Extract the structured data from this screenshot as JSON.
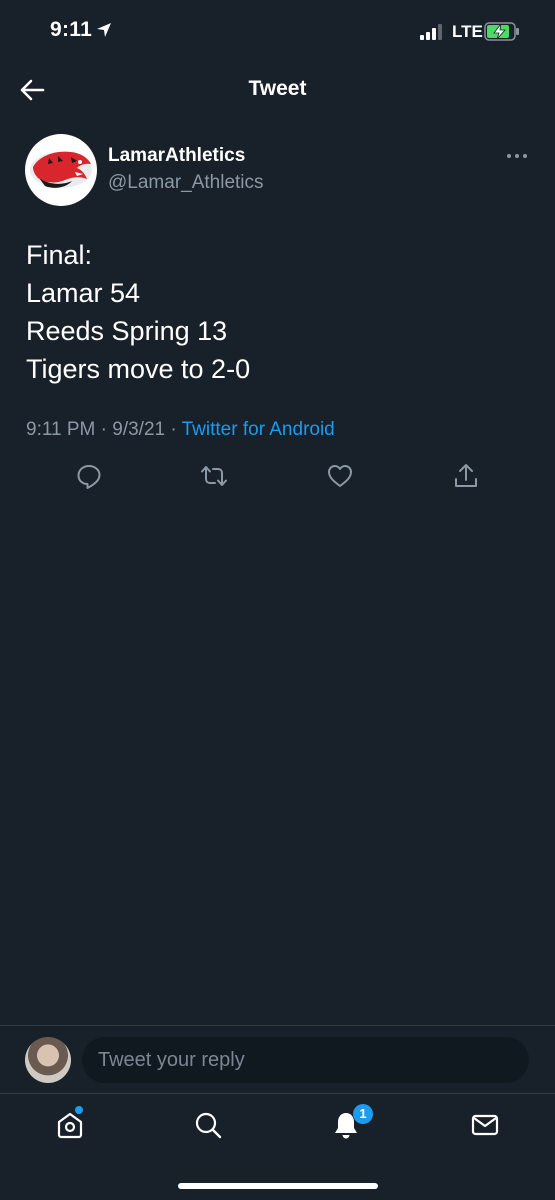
{
  "status_bar": {
    "time": "9:11",
    "carrier": "LTE"
  },
  "header": {
    "title": "Tweet"
  },
  "tweet": {
    "display_name": "LamarAthletics",
    "handle": "@Lamar_Athletics",
    "text_lines": [
      "Final:",
      "Lamar 54",
      "Reeds Spring 13",
      "Tigers move to 2-0"
    ],
    "time": "9:11 PM",
    "date": "9/3/21",
    "source": "Twitter for Android",
    "separator": "·"
  },
  "reply": {
    "placeholder": "Tweet your reply"
  },
  "tab_bar": {
    "notifications_badge": "1"
  },
  "colors": {
    "background": "#182029",
    "accent": "#1d9bf0",
    "secondary_text": "#8b98a5"
  }
}
